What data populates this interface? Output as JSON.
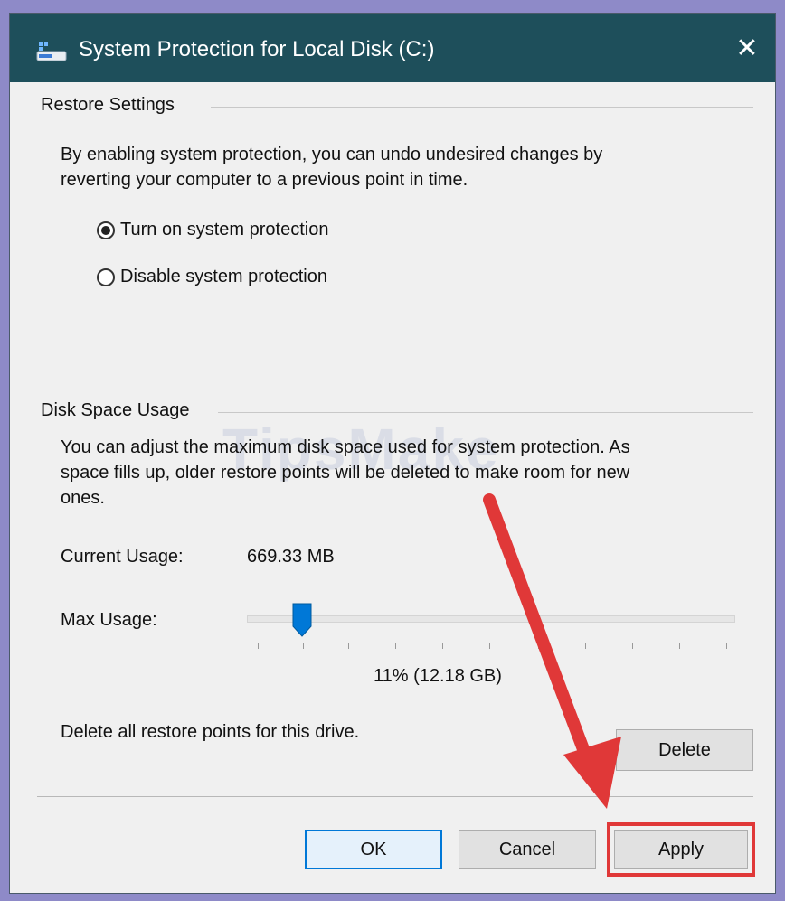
{
  "window": {
    "title": "System Protection for Local Disk (C:)",
    "close_glyph": "✕",
    "icon": "drive-settings-icon"
  },
  "restore_settings": {
    "label": "Restore Settings",
    "description_line1": "By enabling system protection, you can undo undesired changes by",
    "description_line2": "reverting your computer to a previous point in time.",
    "options": [
      {
        "label": "Turn on system protection",
        "selected": true
      },
      {
        "label": "Disable system protection",
        "selected": false
      }
    ]
  },
  "disk_space": {
    "label": "Disk Space Usage",
    "description_line1": "You can adjust the maximum disk space used for system protection. As",
    "description_line2": "space fills up, older restore points will be deleted to make room for new",
    "description_line3": "ones.",
    "current_usage_label": "Current Usage:",
    "current_usage_value": "669.33 MB",
    "max_usage_label": "Max Usage:",
    "max_usage_fraction": 0.11,
    "max_usage_value": "11% (12.18 GB)",
    "delete_text": "Delete all restore points for this drive.",
    "delete_button": "Delete"
  },
  "footer": {
    "ok": "OK",
    "cancel": "Cancel",
    "apply": "Apply"
  },
  "watermark": "TipsMake",
  "colors": {
    "titlebar": "#1e4f5b",
    "dialog_bg": "#f0f0f0",
    "accent": "#0078d7",
    "slider_thumb": "#0078d7",
    "annotation": "#e03838"
  }
}
